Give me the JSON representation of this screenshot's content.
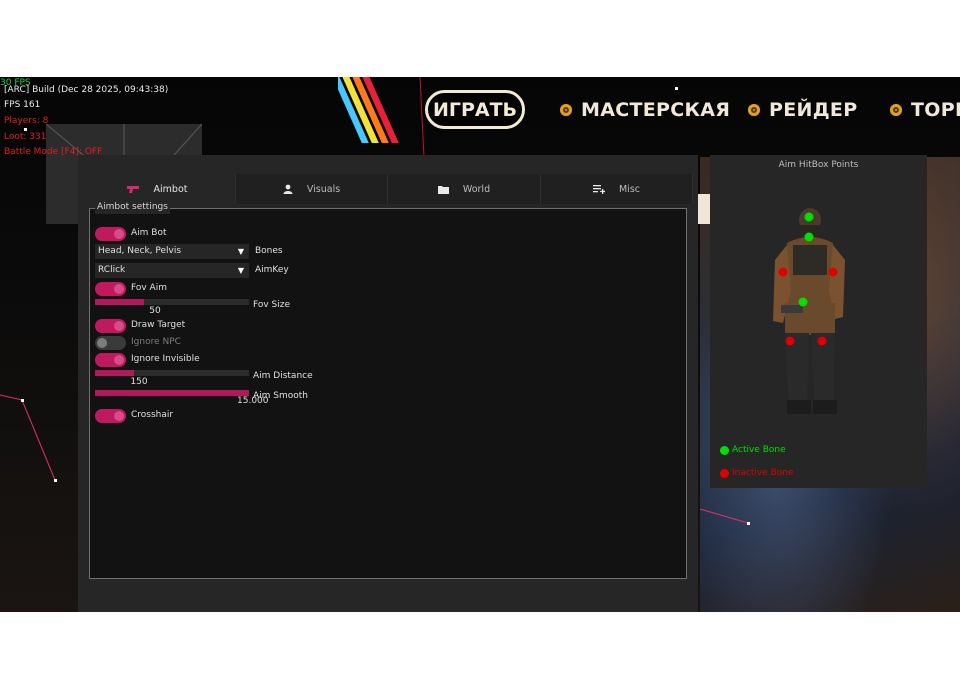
{
  "hud": {
    "fps_corner": "30 FPS",
    "build": "[ARC] Build (Dec 28 2025, 09:43:38)",
    "fps": "FPS 161",
    "players": "Players:  8",
    "loot": "Loot:  331",
    "battle_mode": "Battle Mode [F4]: OFF"
  },
  "game_nav": {
    "play_label": "ИГРАТЬ",
    "items": [
      "МАСТЕРСКАЯ",
      "РЕЙДЕР",
      "ТОРГО"
    ]
  },
  "tabs": [
    {
      "label": "Aimbot",
      "icon": "gun-icon",
      "active": true
    },
    {
      "label": "Visuals",
      "icon": "person-icon",
      "active": false
    },
    {
      "label": "World",
      "icon": "folder-icon",
      "active": false
    },
    {
      "label": "Misc",
      "icon": "list-add-icon",
      "active": false
    }
  ],
  "aimbot": {
    "section_title": "Aimbot settings",
    "aim_bot": {
      "label": "Aim Bot",
      "on": true
    },
    "bones": {
      "value": "Head, Neck, Pelvis",
      "label": "Bones"
    },
    "aim_key": {
      "value": "RClick",
      "label": "AimKey"
    },
    "fov_aim": {
      "label": "Fov Aim",
      "on": true
    },
    "fov_size": {
      "label": "Fov Size",
      "value": "50",
      "fraction": 0.32
    },
    "draw_target": {
      "label": "Draw Target",
      "on": true
    },
    "ignore_npc": {
      "label": "Ignore NPC",
      "on": false
    },
    "ignore_invisible": {
      "label": "Ignore Invisible",
      "on": true
    },
    "aim_distance": {
      "label": "Aim Distance",
      "value": "150",
      "fraction": 0.25
    },
    "aim_smooth": {
      "label": "Aim Smooth",
      "value": "15.000",
      "fraction": 1.0
    },
    "crosshair": {
      "label": "Crosshair",
      "on": true
    }
  },
  "hitbox": {
    "title": "Aim HitBox Points",
    "active_label": "Active Bone",
    "inactive_label": "Inactive Bone",
    "active_color": "#00e000",
    "inactive_color": "#e00000"
  },
  "colors": {
    "accent": "#c0195e"
  }
}
